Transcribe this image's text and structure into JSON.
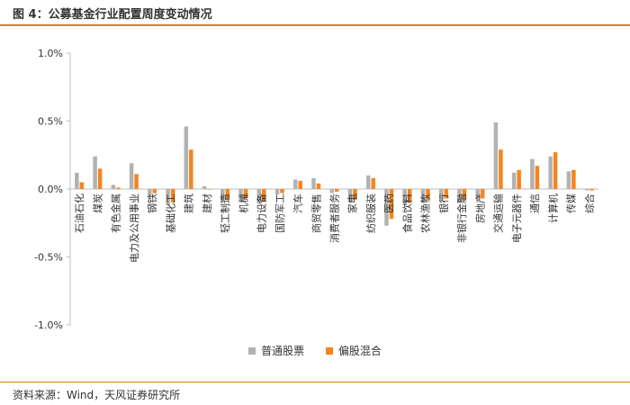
{
  "figure_title": "图 4：公募基金行业配置周度变动情况",
  "source": "资料来源：Wind，天风证券研究所",
  "colors": {
    "accent": "#e07a1f",
    "series_a": "#b2b2b2",
    "series_b": "#f5851f"
  },
  "chart_data": {
    "type": "bar",
    "title": "",
    "xlabel": "",
    "ylabel": "",
    "ylim": [
      -1.0,
      1.0
    ],
    "yticks": [
      "1.0%",
      "0.5%",
      "0.0%",
      "-0.5%",
      "-1.0%"
    ],
    "ytick_values": [
      1.0,
      0.5,
      0.0,
      -0.5,
      -1.0
    ],
    "grid": false,
    "legend": "bottom",
    "categories": [
      "石油石化",
      "煤炭",
      "有色金属",
      "电力及公用事业",
      "钢铁",
      "基础化工",
      "建筑",
      "建材",
      "轻工制造",
      "机械",
      "电力设备",
      "国防军工",
      "汽车",
      "商贸零售",
      "消费者服务",
      "家电",
      "纺织服装",
      "医药",
      "食品饮料",
      "农林渔牧",
      "银行",
      "非银行金融",
      "房地产",
      "交通运输",
      "电子元器件",
      "通信",
      "计算机",
      "传媒",
      "综合"
    ],
    "series": [
      {
        "name": "普通股票",
        "values": [
          0.12,
          0.24,
          0.03,
          0.19,
          -0.05,
          -0.12,
          0.46,
          0.02,
          -0.1,
          -0.09,
          -0.11,
          -0.04,
          0.07,
          0.08,
          -0.03,
          -0.1,
          0.1,
          -0.27,
          -0.12,
          -0.1,
          -0.09,
          -0.1,
          -0.07,
          0.49,
          0.12,
          0.22,
          0.24,
          0.13,
          -0.01
        ]
      },
      {
        "name": "偏股混合",
        "values": [
          0.05,
          0.15,
          0.01,
          0.11,
          -0.03,
          -0.1,
          0.29,
          0.0,
          -0.08,
          -0.07,
          -0.09,
          -0.03,
          0.06,
          0.04,
          -0.02,
          -0.08,
          0.08,
          -0.22,
          -0.1,
          -0.08,
          -0.07,
          -0.08,
          -0.07,
          0.29,
          0.14,
          0.17,
          0.27,
          0.14,
          -0.01
        ]
      }
    ]
  }
}
